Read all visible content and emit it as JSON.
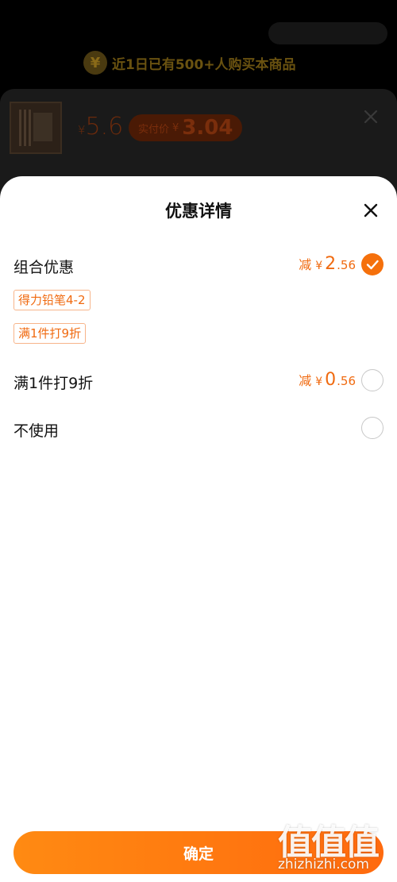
{
  "background": {
    "banner_icon": "¥",
    "banner_text": "近1日已有500+人购买本商品",
    "product": {
      "currency": "¥",
      "price": "5.6",
      "real_price_label": "实付价",
      "real_price_currency": "¥",
      "real_price": "3.04"
    }
  },
  "sheet": {
    "title": "优惠详情",
    "options": [
      {
        "label": "组合优惠",
        "discount_prefix": "减",
        "currency": "¥",
        "discount_int": "2",
        "discount_dec": ".56",
        "selected": true,
        "tags": [
          "得力铅笔4-2",
          "满1件打9折"
        ]
      },
      {
        "label": "满1件打9折",
        "discount_prefix": "减",
        "currency": "¥",
        "discount_int": "0",
        "discount_dec": ".56",
        "selected": false
      },
      {
        "label": "不使用",
        "selected": false
      }
    ],
    "confirm_label": "确定"
  },
  "watermark": {
    "glyphs": "值值值",
    "url": "zhizhizhi.com"
  },
  "colors": {
    "accent": "#f5700c",
    "tag_border": "#f7b48a",
    "button_start": "#ff8a12",
    "button_end": "#ff6a0e"
  }
}
